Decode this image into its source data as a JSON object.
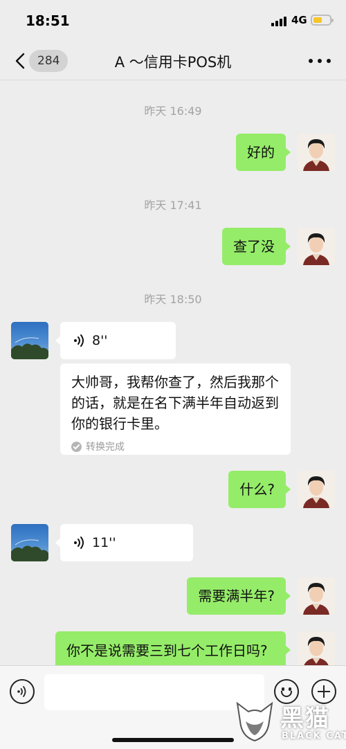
{
  "status_bar": {
    "time": "18:51",
    "network": "4G",
    "battery_level": 0.55,
    "battery_color": "#f5c52a"
  },
  "nav": {
    "back_icon": "chevron-left-icon",
    "unread_count": "284",
    "title": "A ～信用卡POS机",
    "more_icon": "more-dots-icon"
  },
  "messages": [
    {
      "type": "timestamp",
      "text": "昨天 16:49"
    },
    {
      "type": "text",
      "direction": "out",
      "text": "好的"
    },
    {
      "type": "timestamp",
      "text": "昨天 17:41"
    },
    {
      "type": "text",
      "direction": "out",
      "text": "查了没"
    },
    {
      "type": "timestamp",
      "text": "昨天 18:50"
    },
    {
      "type": "voice",
      "direction": "in",
      "duration": "8''"
    },
    {
      "type": "transcript",
      "direction": "in",
      "text": "大帅哥，我帮你查了，然后我那个的话，就是在名下满半年自动返到你的银行卡里。",
      "status": "转换完成"
    },
    {
      "type": "text",
      "direction": "out",
      "text": "什么?"
    },
    {
      "type": "voice",
      "direction": "in",
      "duration": "11''"
    },
    {
      "type": "text",
      "direction": "out",
      "text": "需要满半年?"
    },
    {
      "type": "text",
      "direction": "out",
      "text": "你不是说需要三到七个工作日吗?"
    }
  ],
  "input_bar": {
    "voice_icon": "voice-toggle-icon",
    "input_value": "",
    "emoji_icon": "emoji-icon",
    "plus_icon": "plus-icon"
  },
  "watermark": {
    "text_cn": "黑猫",
    "text_en": "BLACK CAT"
  },
  "colors": {
    "outgoing_bubble": "#95ec69",
    "incoming_bubble": "#ffffff",
    "background": "#ededed"
  }
}
